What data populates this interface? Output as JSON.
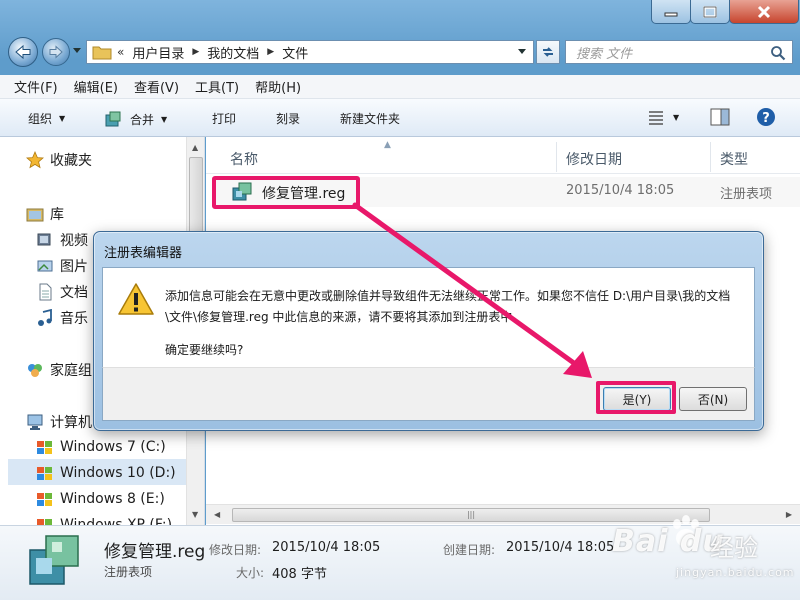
{
  "nav": {
    "breadcrumb": [
      "用户目录",
      "我的文档",
      "文件"
    ],
    "overflow": "«",
    "search_placeholder": "搜索 文件"
  },
  "menubar": [
    "文件(F)",
    "编辑(E)",
    "查看(V)",
    "工具(T)",
    "帮助(H)"
  ],
  "commands": {
    "organize": "组织",
    "merge": "合并",
    "print": "打印",
    "burn": "刻录",
    "new_folder": "新建文件夹"
  },
  "navpane": {
    "favorites": "收藏夹",
    "libraries": "库",
    "videos": "视频",
    "pictures": "图片",
    "documents": "文档",
    "music": "音乐",
    "homegroup": "家庭组",
    "computer": "计算机",
    "drives": [
      "Windows 7 (C:)",
      "Windows 10 (D:)",
      "Windows 8 (E:)",
      "Windows XP (F:)"
    ]
  },
  "columns": {
    "name": "名称",
    "modified": "修改日期",
    "type": "类型"
  },
  "file": {
    "name": "修复管理.reg",
    "modified": "2015/10/4 18:05",
    "type": "注册表项"
  },
  "details": {
    "name": "修复管理.reg",
    "type": "注册表项",
    "modified_label": "修改日期:",
    "modified_value": "2015/10/4 18:05",
    "size_label": "大小:",
    "size_value": "408 字节",
    "created_label": "创建日期:",
    "created_value": "2015/10/4 18:05"
  },
  "dialog": {
    "title": "注册表编辑器",
    "message": "添加信息可能会在无意中更改或删除值并导致组件无法继续正常工作。如果您不信任 D:\\用户目录\\我的文档\\文件\\修复管理.reg 中此信息的来源，请不要将其添加到注册表中。",
    "confirm": "确定要继续吗?",
    "yes": "是(Y)",
    "no": "否(N)"
  },
  "watermark": {
    "brand": "Bai du",
    "product": "经验",
    "url": "jingyan.baidu.com"
  },
  "colors": {
    "highlight": "#e8186a",
    "frame": "#5e9ccb"
  }
}
